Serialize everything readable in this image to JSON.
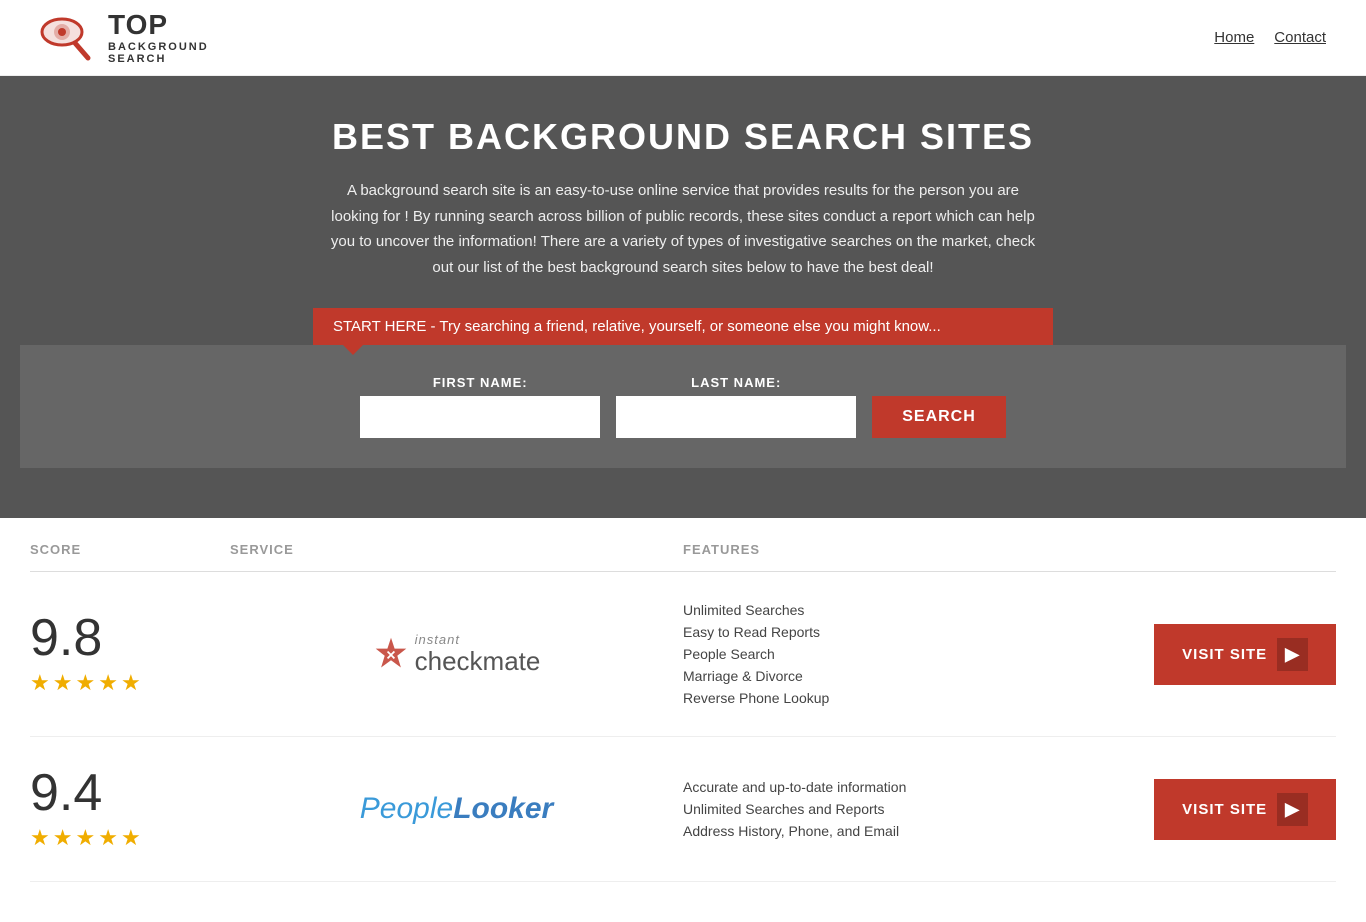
{
  "header": {
    "logo_top": "TOP",
    "logo_bottom": "BACKGROUND\nSEARCH",
    "nav": [
      {
        "label": "Home",
        "href": "#"
      },
      {
        "label": "Contact",
        "href": "#"
      }
    ]
  },
  "hero": {
    "title": "BEST BACKGROUND SEARCH SITES",
    "description": "A background search site is an easy-to-use online service that provides results  for the person you are looking for ! By  running  search across billion of public records, these sites conduct  a report which can help you to uncover the information! There are a variety of types of investigative searches on the market, check out our  list of the best background search sites below to have the best deal!",
    "search_banner": "START HERE - Try searching a friend, relative, yourself, or someone else you might know..."
  },
  "search_form": {
    "first_name_label": "FIRST NAME:",
    "last_name_label": "LAST NAME:",
    "first_name_placeholder": "",
    "last_name_placeholder": "",
    "button_label": "SEARCH"
  },
  "table": {
    "headers": {
      "score": "SCORE",
      "service": "SERVICE",
      "features": "FEATURES",
      "action": ""
    },
    "rows": [
      {
        "score": "9.8",
        "stars": 4.5,
        "service_name": "Instant Checkmate",
        "service_type": "checkmate",
        "features": [
          "Unlimited Searches",
          "Easy to Read Reports",
          "People Search",
          "Marriage & Divorce",
          "Reverse Phone Lookup"
        ],
        "visit_label": "VISIT SITE"
      },
      {
        "score": "9.4",
        "stars": 4.5,
        "service_name": "PeopleLooker",
        "service_type": "peoplelooker",
        "features": [
          "Accurate and up-to-date information",
          "Unlimited Searches and Reports",
          "Address History, Phone, and Email"
        ],
        "visit_label": "VISIT SITE"
      }
    ]
  },
  "colors": {
    "primary_red": "#c0392b",
    "star_gold": "#f0ad00",
    "dark_gray": "#555",
    "light_gray": "#999"
  }
}
